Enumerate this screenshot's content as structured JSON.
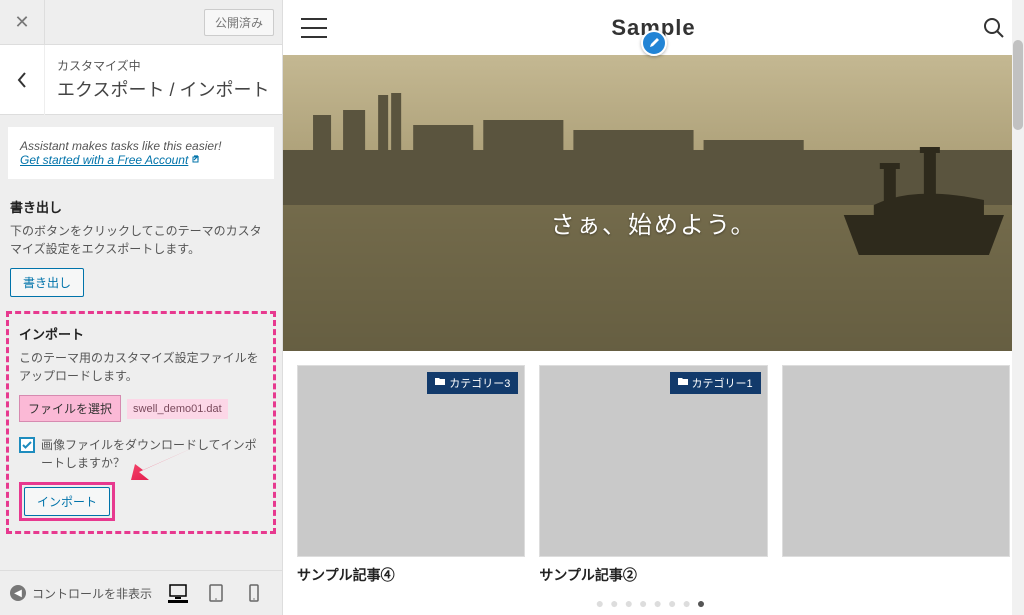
{
  "customizer": {
    "publish_state": "公開済み",
    "breadcrumb": "カスタマイズ中",
    "panel_title": "エクスポート / インポート",
    "assistant": {
      "text": "Assistant makes tasks like this easier!",
      "link_text": "Get started with a Free Account"
    },
    "export": {
      "heading": "書き出し",
      "description": "下のボタンをクリックしてこのテーマのカスタマイズ設定をエクスポートします。",
      "button": "書き出し"
    },
    "import": {
      "heading": "インポート",
      "description": "このテーマ用のカスタマイズ設定ファイルをアップロードします。",
      "choose_file_label": "ファイルを選択",
      "file_name": "swell_demo01.dat",
      "checkbox_label": "画像ファイルをダウンロードしてインポートしますか？",
      "button": "インポート"
    },
    "footer": {
      "collapse_label": "コントロールを非表示"
    }
  },
  "preview": {
    "site_title": "Sample",
    "hero_text": "さぁ、始めよう。",
    "cards": [
      {
        "category": "カテゴリー3",
        "title": "サンプル記事④"
      },
      {
        "category": "カテゴリー1",
        "title": "サンプル記事②"
      },
      {
        "category": "",
        "title": ""
      }
    ],
    "pager_index": 7,
    "pager_total": 8
  }
}
